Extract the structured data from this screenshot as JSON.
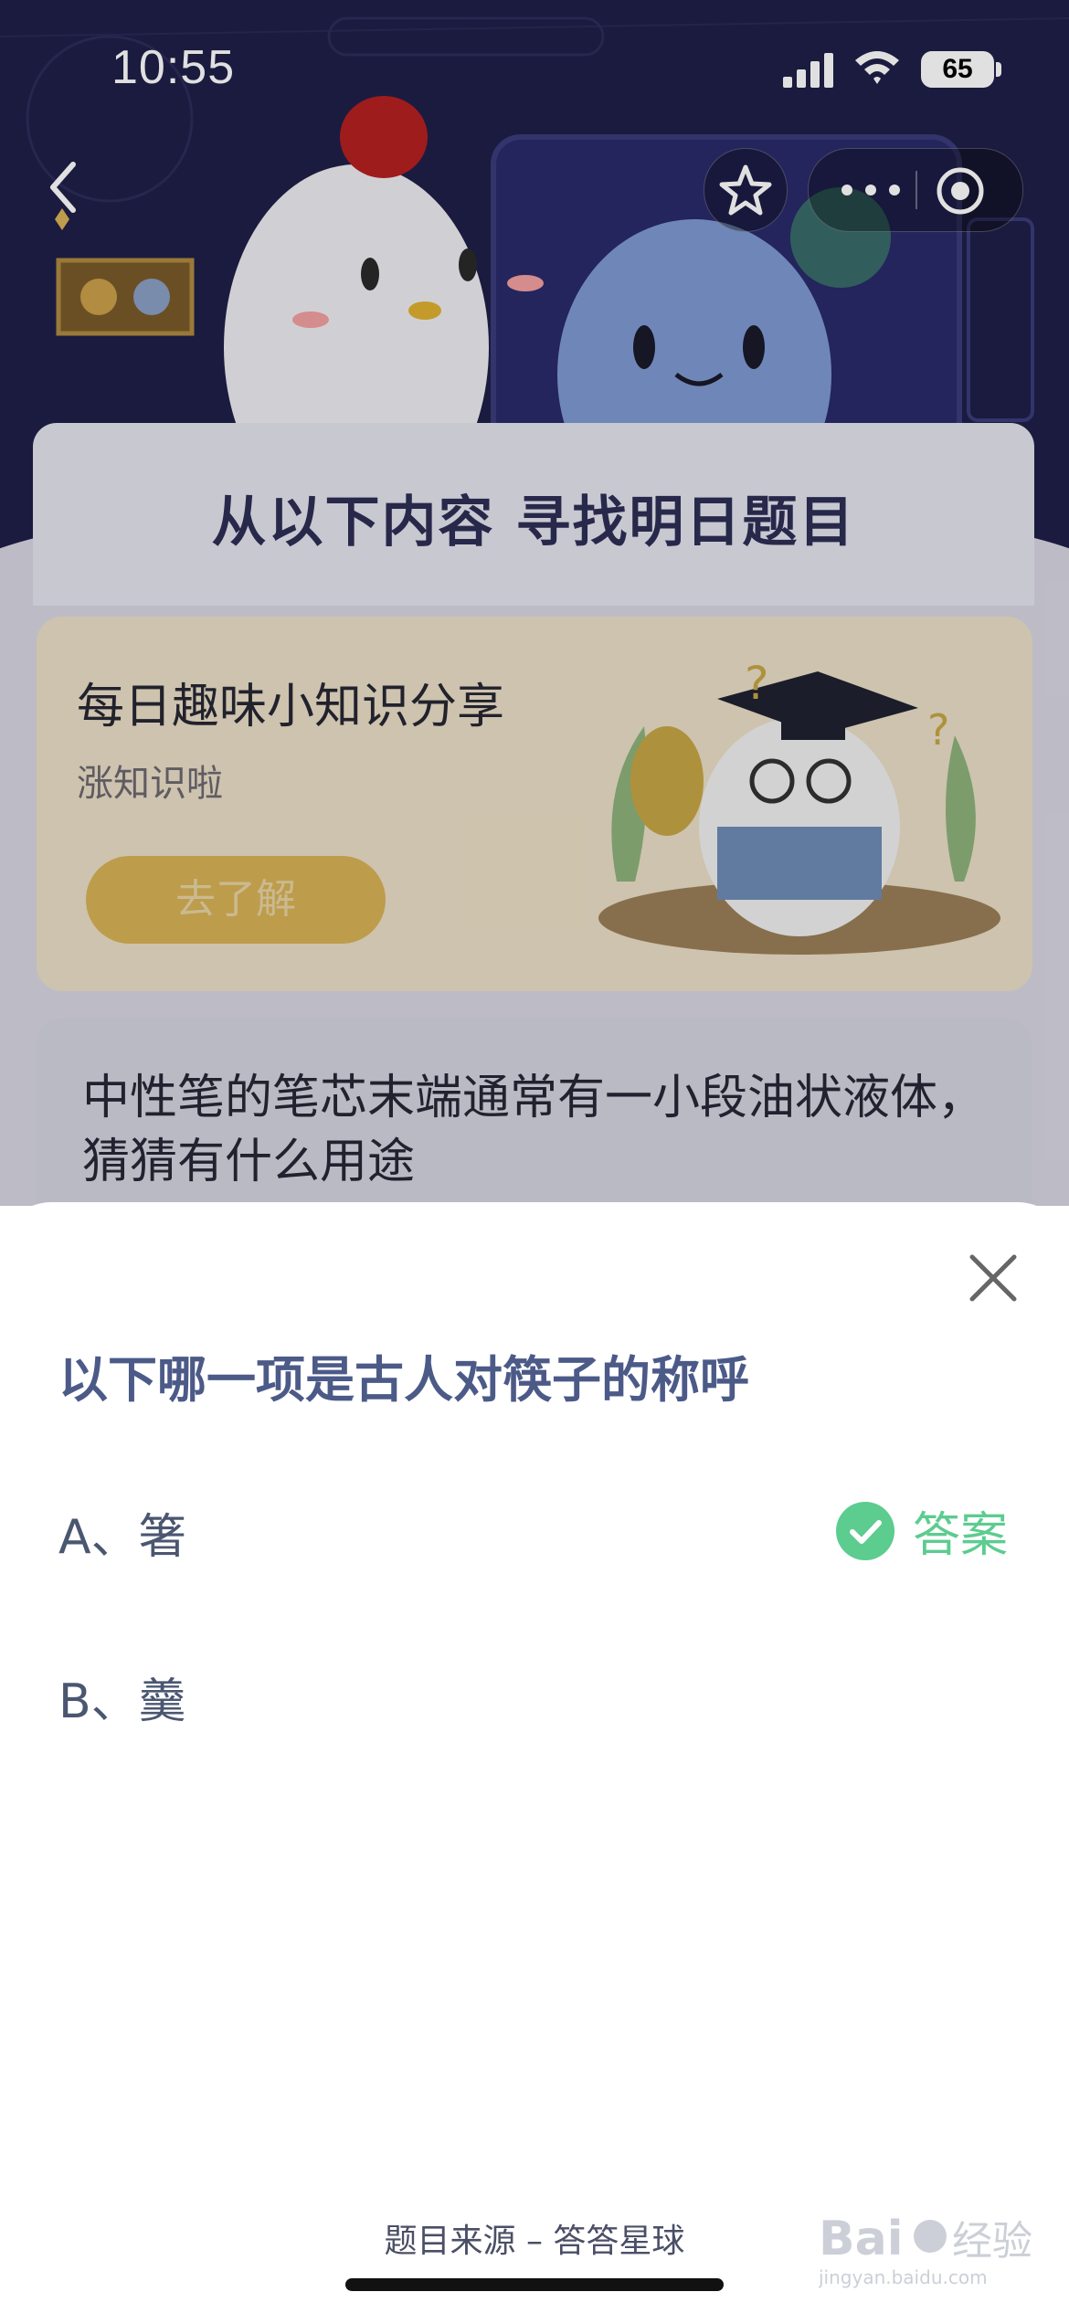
{
  "status_bar": {
    "time": "10:55",
    "battery": "65"
  },
  "page": {
    "banner_title": "从以下内容 寻找明日题目"
  },
  "cards": {
    "card1": {
      "title": "每日趣味小知识分享",
      "subtitle": "涨知识啦",
      "button": "去了解"
    },
    "card2": {
      "question": "中性笔的笔芯末端通常有一小段油状液体，猜猜有什么用途"
    }
  },
  "sheet": {
    "question": "以下哪一项是古人对筷子的称呼",
    "options": [
      {
        "label": "A、箸"
      },
      {
        "label": "B、羹"
      }
    ],
    "answer_label": "答案",
    "source": "题目来源 – 答答星球"
  },
  "colors": {
    "hero_bg": "#1f1f48",
    "question_text": "#4c5a88",
    "answer_green": "#5ccc8f",
    "card1_button": "#d8b257"
  },
  "icons": [
    "back-icon",
    "star-icon",
    "more-icon",
    "target-icon",
    "close-icon",
    "check-icon"
  ]
}
